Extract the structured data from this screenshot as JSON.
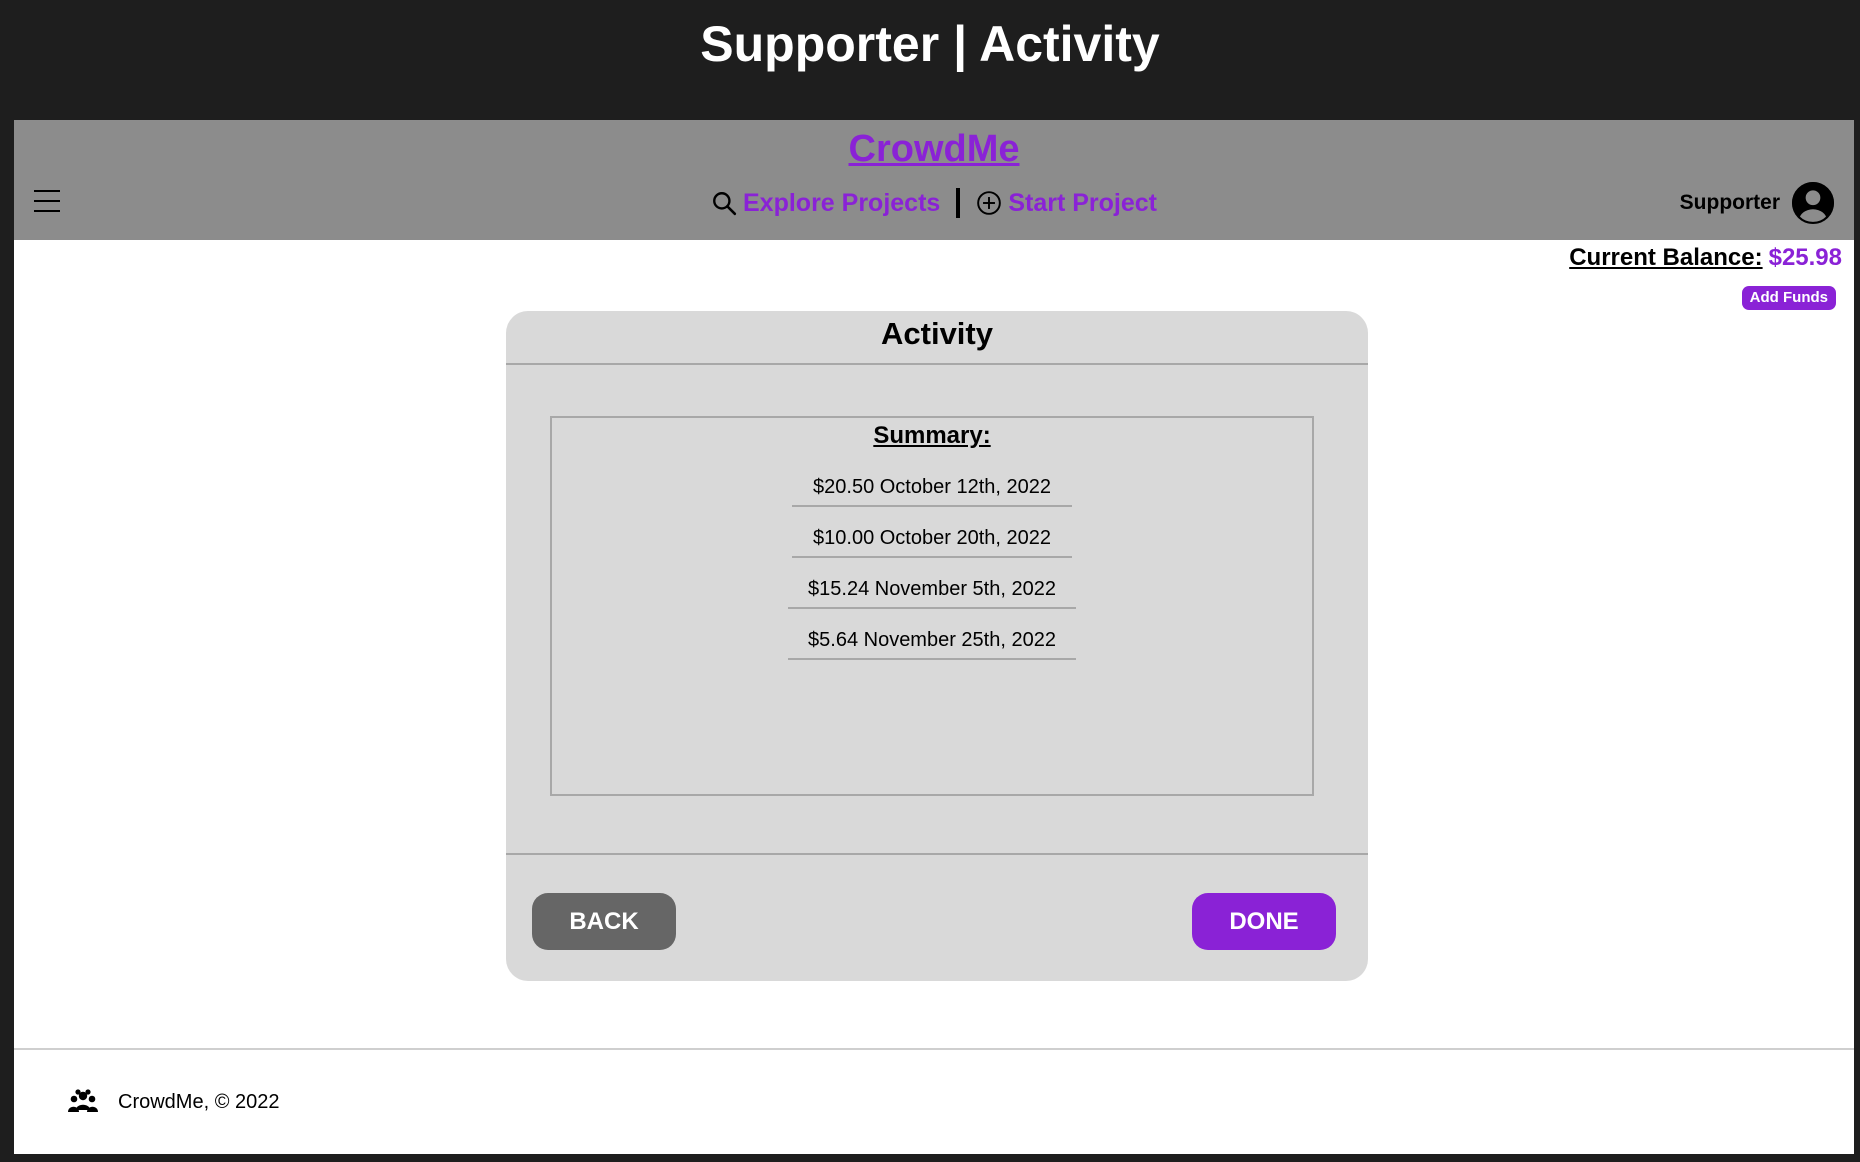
{
  "window": {
    "title": "Supporter | Activity"
  },
  "nav": {
    "brand": "CrowdMe",
    "menu_icon": "hamburger-menu-icon",
    "links": [
      {
        "label": "Explore Projects",
        "icon": "search-icon"
      },
      {
        "label": "Start Project",
        "icon": "plus-circle-icon"
      }
    ],
    "user": {
      "label": "Supporter",
      "icon": "user-avatar-icon"
    }
  },
  "balance": {
    "label": "Current Balance:",
    "amount": "$25.98",
    "add_funds": "Add Funds"
  },
  "card": {
    "title": "Activity",
    "summary_title": "Summary:",
    "items": [
      "$20.50 October 12th, 2022",
      "$10.00 October 20th, 2022",
      "$15.24 November 5th, 2022",
      "$5.64 November 25th, 2022"
    ],
    "back_label": "BACK",
    "done_label": "DONE"
  },
  "footer": {
    "text": "CrowdMe, © 2022",
    "icon": "group-icon"
  },
  "colors": {
    "accent": "#8a22d6",
    "header_bg": "#1e1e1e",
    "nav_bg": "#8c8c8c",
    "card_bg": "#d9d9d9",
    "back_button": "#666666"
  }
}
